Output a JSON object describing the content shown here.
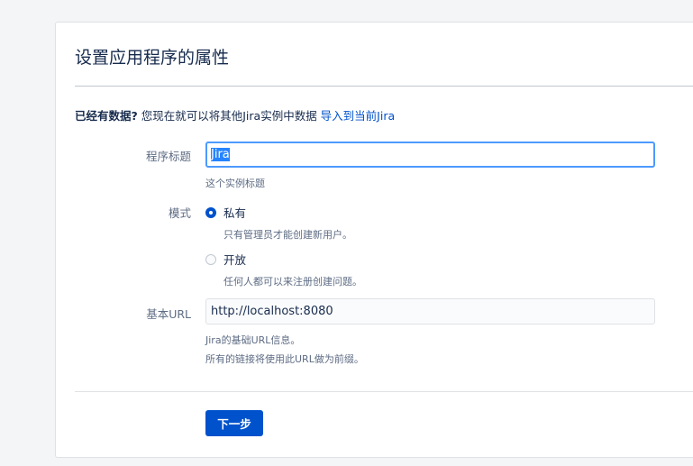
{
  "page": {
    "title": "设置应用程序的属性"
  },
  "notice": {
    "bold": "已经有数据?",
    "text": " 您现在就可以将其他Jira实例中数据 ",
    "link": "导入到当前Jira"
  },
  "form": {
    "app_title": {
      "label": "程序标题",
      "value": "Jira",
      "description": "这个实例标题"
    },
    "mode": {
      "label": "模式",
      "options": [
        {
          "label": "私有",
          "description": "只有管理员才能创建新用户。",
          "selected": true
        },
        {
          "label": "开放",
          "description": "任何人都可以来注册创建问题。",
          "selected": false
        }
      ]
    },
    "base_url": {
      "label": "基本URL",
      "value": "http://localhost:8080",
      "description_line1": "Jira的基础URL信息。",
      "description_line2": "所有的链接将使用此URL做为前缀。"
    }
  },
  "actions": {
    "next_label": "下一步"
  },
  "colors": {
    "primary": "#0052cc",
    "focus_border": "#4c9aff",
    "text": "#172b4d",
    "muted": "#5e6c84"
  }
}
